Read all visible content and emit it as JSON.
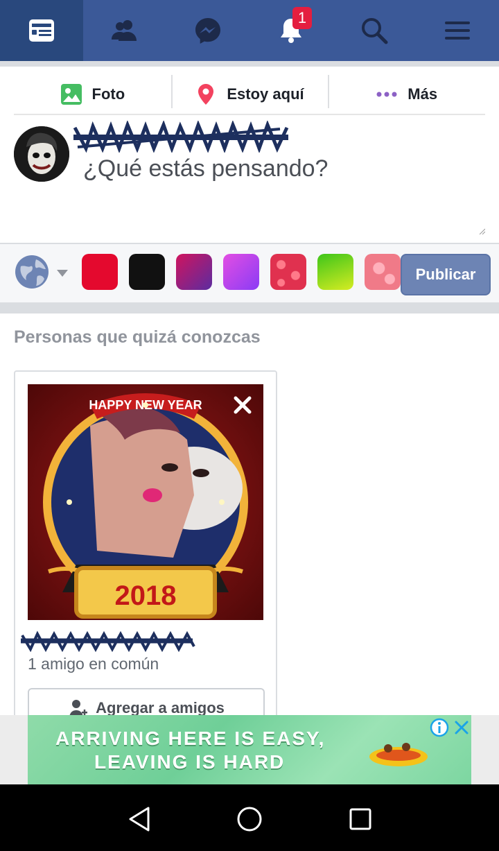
{
  "topnav": {
    "tabs": [
      {
        "name": "news-feed",
        "icon": "news-feed-icon"
      },
      {
        "name": "friends",
        "icon": "friends-icon"
      },
      {
        "name": "messenger",
        "icon": "messenger-icon"
      },
      {
        "name": "notifications",
        "icon": "bell-icon",
        "badge": "1"
      },
      {
        "name": "search",
        "icon": "search-icon"
      },
      {
        "name": "menu",
        "icon": "hamburger-menu-icon"
      }
    ],
    "colors": {
      "bar": "#3b5998",
      "active": "#29487d",
      "badge": "#e41e3f"
    }
  },
  "composer": {
    "actions": [
      {
        "label": "Foto",
        "icon": "photo-icon"
      },
      {
        "label": "Estoy aquí",
        "icon": "location-pin-icon"
      },
      {
        "label": "Más",
        "icon": "more-dots-icon"
      }
    ],
    "placeholder": "¿Qué estás pensando?",
    "swatches": [
      "#e4092e",
      "#111111",
      "gradient-magenta-purple",
      "gradient-violet",
      "hearts-pattern",
      "gradient-green-yellow",
      "pink-pattern"
    ],
    "publish_label": "Publicar"
  },
  "pymk": {
    "title": "Personas que quizá conozcas",
    "card": {
      "photo_banner": "HAPPY NEW YEAR",
      "photo_year": "2018",
      "mutual": "1 amigo en común",
      "add_label": "Agregar a amigos"
    }
  },
  "ad": {
    "line1": "ARRIVING HERE IS EASY,",
    "line2": "LEAVING IS HARD"
  }
}
